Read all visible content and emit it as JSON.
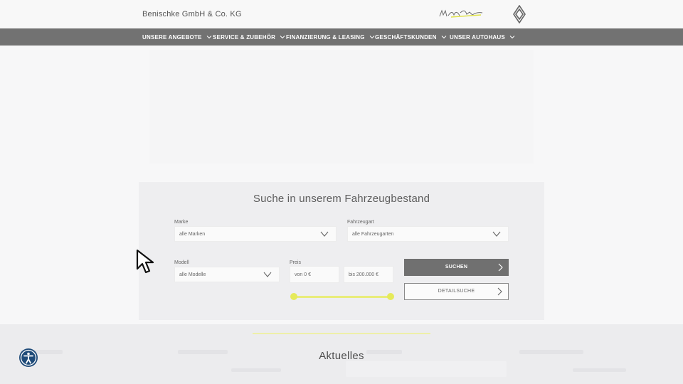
{
  "header": {
    "company": "Benischke GmbH & Co. KG"
  },
  "nav": {
    "items": [
      {
        "label": "UNSERE ANGEBOTE"
      },
      {
        "label": "SERVICE & ZUBEHÖR"
      },
      {
        "label": "FINANZIERUNG & LEASING"
      },
      {
        "label": "GESCHÄFTSKUNDEN"
      },
      {
        "label": "UNSER AUTOHAUS"
      }
    ]
  },
  "search": {
    "title": "Suche in unserem Fahrzeugbestand",
    "marke": {
      "label": "Marke",
      "value": "alle Marken"
    },
    "fahrzeugart": {
      "label": "Fahrzeugart",
      "value": "alle Fahrzeugarten"
    },
    "modell": {
      "label": "Modell",
      "value": "alle Modelle"
    },
    "preis": {
      "label": "Preis",
      "from": "von 0 €",
      "to": "bis 200.000 €"
    },
    "search_button": "SUCHEN",
    "detail_button": "DETAILSUCHE"
  },
  "news": {
    "title": "Aktuelles"
  },
  "colors": {
    "nav_bg": "#727272",
    "accent_yellow": "#e5ea5a",
    "button_bg": "#707070"
  },
  "icons": {
    "accessibility": "accessibility-icon",
    "cursor": "mouse-pointer-icon",
    "brand": "renault-logo-icon"
  }
}
